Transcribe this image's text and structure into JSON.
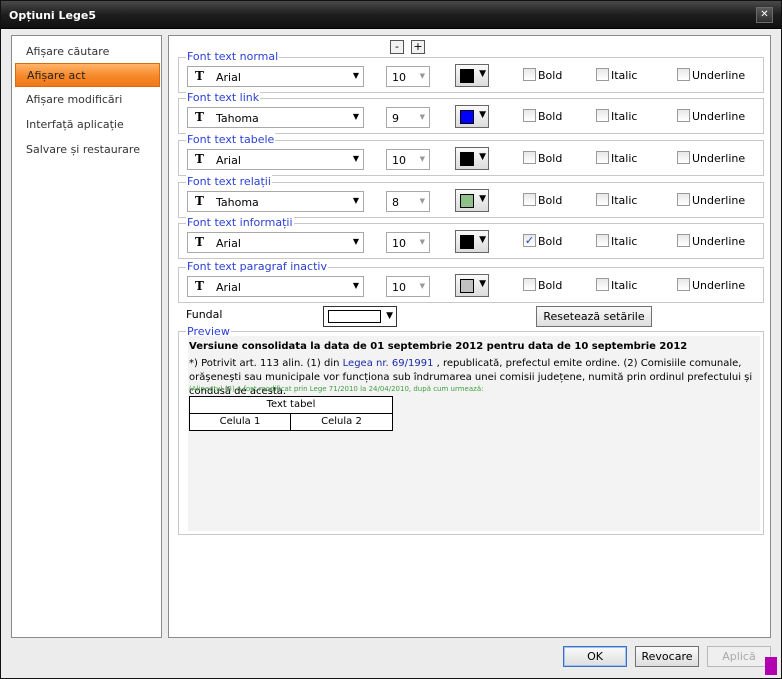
{
  "window": {
    "title": "Opțiuni Lege5",
    "close_glyph": "✕"
  },
  "sidebar": {
    "items": [
      {
        "label": "Afișare căutare"
      },
      {
        "label": "Afișare act"
      },
      {
        "label": "Afișare modificări"
      },
      {
        "label": "Interfață aplicație"
      },
      {
        "label": "Salvare și restaurare"
      }
    ],
    "selected_index": 1
  },
  "zoom": {
    "minus": "-",
    "plus": "+"
  },
  "font_groups": [
    {
      "label": "Font text normal",
      "font": "Arial",
      "size": "10",
      "color": "#000000",
      "bold": false,
      "italic": false,
      "underline": false
    },
    {
      "label": "Font text link",
      "font": "Tahoma",
      "size": "9",
      "color": "#0000ff",
      "bold": false,
      "italic": false,
      "underline": false
    },
    {
      "label": "Font text tabele",
      "font": "Arial",
      "size": "10",
      "color": "#000000",
      "bold": false,
      "italic": false,
      "underline": false
    },
    {
      "label": "Font text relații",
      "font": "Tahoma",
      "size": "8",
      "color": "#8fc08a",
      "bold": false,
      "italic": false,
      "underline": false
    },
    {
      "label": "Font text informații",
      "font": "Arial",
      "size": "10",
      "color": "#000000",
      "bold": true,
      "italic": false,
      "underline": false
    },
    {
      "label": "Font text paragraf inactiv",
      "font": "Arial",
      "size": "10",
      "color": "#c0c0c0",
      "bold": false,
      "italic": false,
      "underline": false
    }
  ],
  "style_labels": {
    "bold": "Bold",
    "italic": "Italic",
    "underline": "Underline"
  },
  "icons": {
    "font": "font-type-icon",
    "dropdown": "▼",
    "check": "✓"
  },
  "fundal": {
    "label": "Fundal",
    "color": "#ffffff"
  },
  "reset_button": "Resetează setările",
  "preview": {
    "label": "Preview",
    "title": "Versiune consolidata la data de 01 septembrie 2012 pentru data de 10 septembrie 2012",
    "text_before": "*) Potrivit art. 113 alin. (1) din ",
    "link": "Legea nr. 69/1991",
    "text_after": " , republicată, prefectul emite ordine. (2) Comisiile comunale, orășenești sau municipale vor funcționa sub îndrumarea unei comisii județene, numită prin ordinul prefectului și condusă de acesta.",
    "note": "(Alineatul (3) a fost modificat prin Lege 71/2010 la 24/04/2010, după cum urmează:",
    "table_header": "Text tabel",
    "cell1": "Celula 1",
    "cell2": "Celula 2"
  },
  "buttons": {
    "ok": "OK",
    "cancel": "Revocare",
    "apply": "Aplică"
  }
}
